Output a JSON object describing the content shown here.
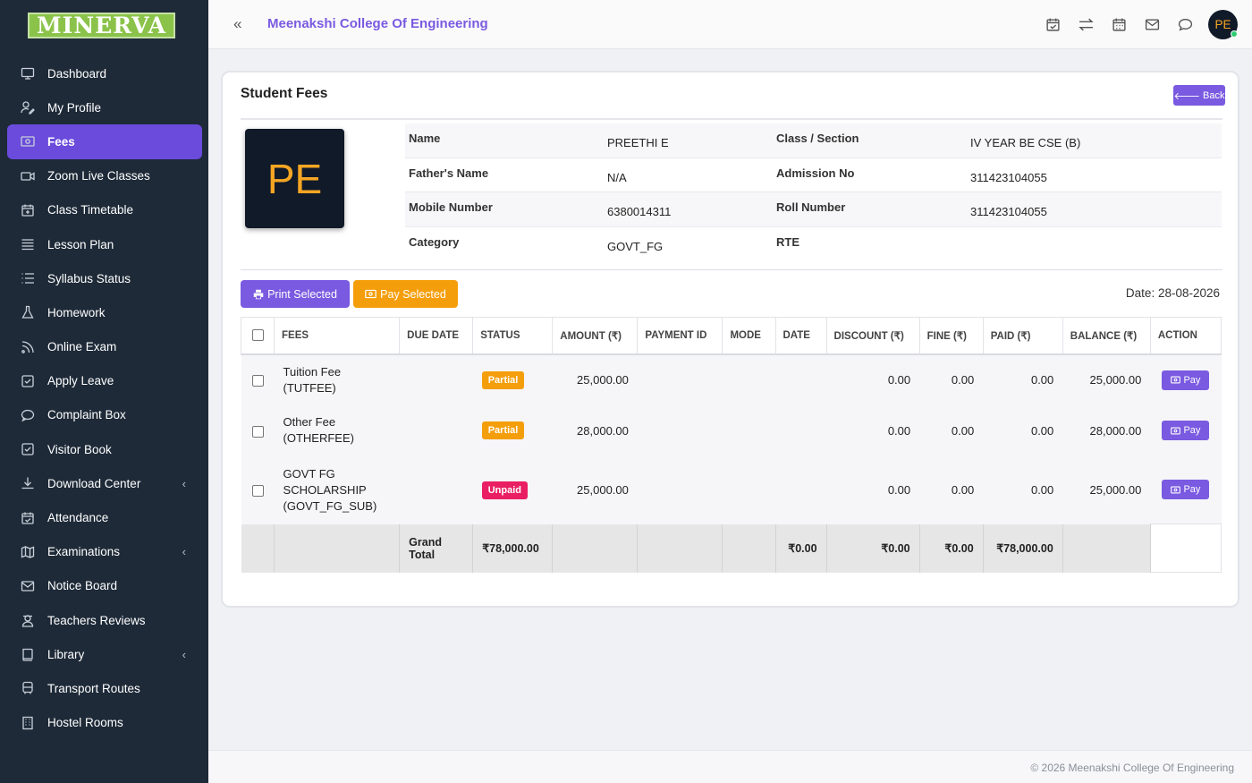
{
  "brand": {
    "logo_text": "MINERVA"
  },
  "sidebar": {
    "items": [
      {
        "label": "Dashboard",
        "icon": "monitor-icon"
      },
      {
        "label": "My Profile",
        "icon": "user-edit-icon"
      },
      {
        "label": "Fees",
        "icon": "money-icon",
        "active": true
      },
      {
        "label": "Zoom Live Classes",
        "icon": "video-icon"
      },
      {
        "label": "Class Timetable",
        "icon": "calendar-plus-icon"
      },
      {
        "label": "Lesson Plan",
        "icon": "list-icon"
      },
      {
        "label": "Syllabus Status",
        "icon": "list-check-icon"
      },
      {
        "label": "Homework",
        "icon": "flask-icon"
      },
      {
        "label": "Online Exam",
        "icon": "rss-icon"
      },
      {
        "label": "Apply Leave",
        "icon": "check-square-icon"
      },
      {
        "label": "Complaint Box",
        "icon": "comment-icon"
      },
      {
        "label": "Visitor Book",
        "icon": "check-square-icon"
      },
      {
        "label": "Download Center",
        "icon": "download-icon",
        "submenu": true
      },
      {
        "label": "Attendance",
        "icon": "calendar-check-icon"
      },
      {
        "label": "Examinations",
        "icon": "map-icon",
        "submenu": true
      },
      {
        "label": "Notice Board",
        "icon": "envelope-icon"
      },
      {
        "label": "Teachers Reviews",
        "icon": "user-secret-icon"
      },
      {
        "label": "Library",
        "icon": "book-icon",
        "submenu": true
      },
      {
        "label": "Transport Routes",
        "icon": "bus-icon"
      },
      {
        "label": "Hostel Rooms",
        "icon": "building-icon"
      }
    ]
  },
  "header": {
    "college_name": "Meenakshi College Of Engineering",
    "avatar_initials": "PE"
  },
  "card": {
    "title": "Student Fees",
    "back_label": "Back",
    "photo_initials": "PE",
    "info": {
      "name_label": "Name",
      "name": "PREETHI E",
      "class_label": "Class / Section",
      "class": "IV YEAR BE CSE (B)",
      "father_label": "Father's Name",
      "father": "N/A",
      "admission_label": "Admission No",
      "admission": "311423104055",
      "mobile_label": "Mobile Number",
      "mobile": "6380014311",
      "roll_label": "Roll Number",
      "roll": "311423104055",
      "category_label": "Category",
      "category": "GOVT_FG",
      "rte_label": "RTE",
      "rte": ""
    },
    "print_selected_label": "Print Selected",
    "pay_selected_label": "Pay Selected",
    "date_text": "Date: 28-08-2026"
  },
  "table": {
    "headers": [
      "FEES",
      "DUE DATE",
      "STATUS",
      "AMOUNT (₹)",
      "PAYMENT ID",
      "MODE",
      "DATE",
      "DISCOUNT (₹)",
      "FINE (₹)",
      "PAID (₹)",
      "BALANCE (₹)",
      "ACTION"
    ],
    "rows": [
      {
        "fee_line1": "Tuition Fee",
        "fee_line2": "(TUTFEE)",
        "fee_line3": "",
        "due_date": "",
        "status": "Partial",
        "status_color": "#f59e0b",
        "amount": "25,000.00",
        "payment_id": "",
        "mode": "",
        "date": "",
        "discount": "0.00",
        "fine": "0.00",
        "paid": "0.00",
        "balance": "25,000.00",
        "action": "Pay"
      },
      {
        "fee_line1": "Other Fee",
        "fee_line2": "(OTHERFEE)",
        "fee_line3": "",
        "due_date": "",
        "status": "Partial",
        "status_color": "#f59e0b",
        "amount": "28,000.00",
        "payment_id": "",
        "mode": "",
        "date": "",
        "discount": "0.00",
        "fine": "0.00",
        "paid": "0.00",
        "balance": "28,000.00",
        "action": "Pay"
      },
      {
        "fee_line1": "GOVT FG",
        "fee_line2": "SCHOLARSHIP",
        "fee_line3": "(GOVT_FG_SUB)",
        "due_date": "",
        "status": "Unpaid",
        "status_color": "#e91e63",
        "amount": "25,000.00",
        "payment_id": "",
        "mode": "",
        "date": "",
        "discount": "0.00",
        "fine": "0.00",
        "paid": "0.00",
        "balance": "25,000.00",
        "action": "Pay"
      }
    ],
    "total": {
      "label_line1": "Grand",
      "label_line2": "Total",
      "amount": "₹78,000.00",
      "date_col": "₹0.00",
      "discount": "₹0.00",
      "fine": "₹0.00",
      "paid": "₹78,000.00"
    }
  },
  "footer": {
    "text": "© 2026 Meenakshi College Of Engineering"
  },
  "colors": {
    "accent": "#7a5ae0",
    "warning": "#f59e0b",
    "danger": "#e91e63",
    "sidebar": "#1e2a38"
  }
}
